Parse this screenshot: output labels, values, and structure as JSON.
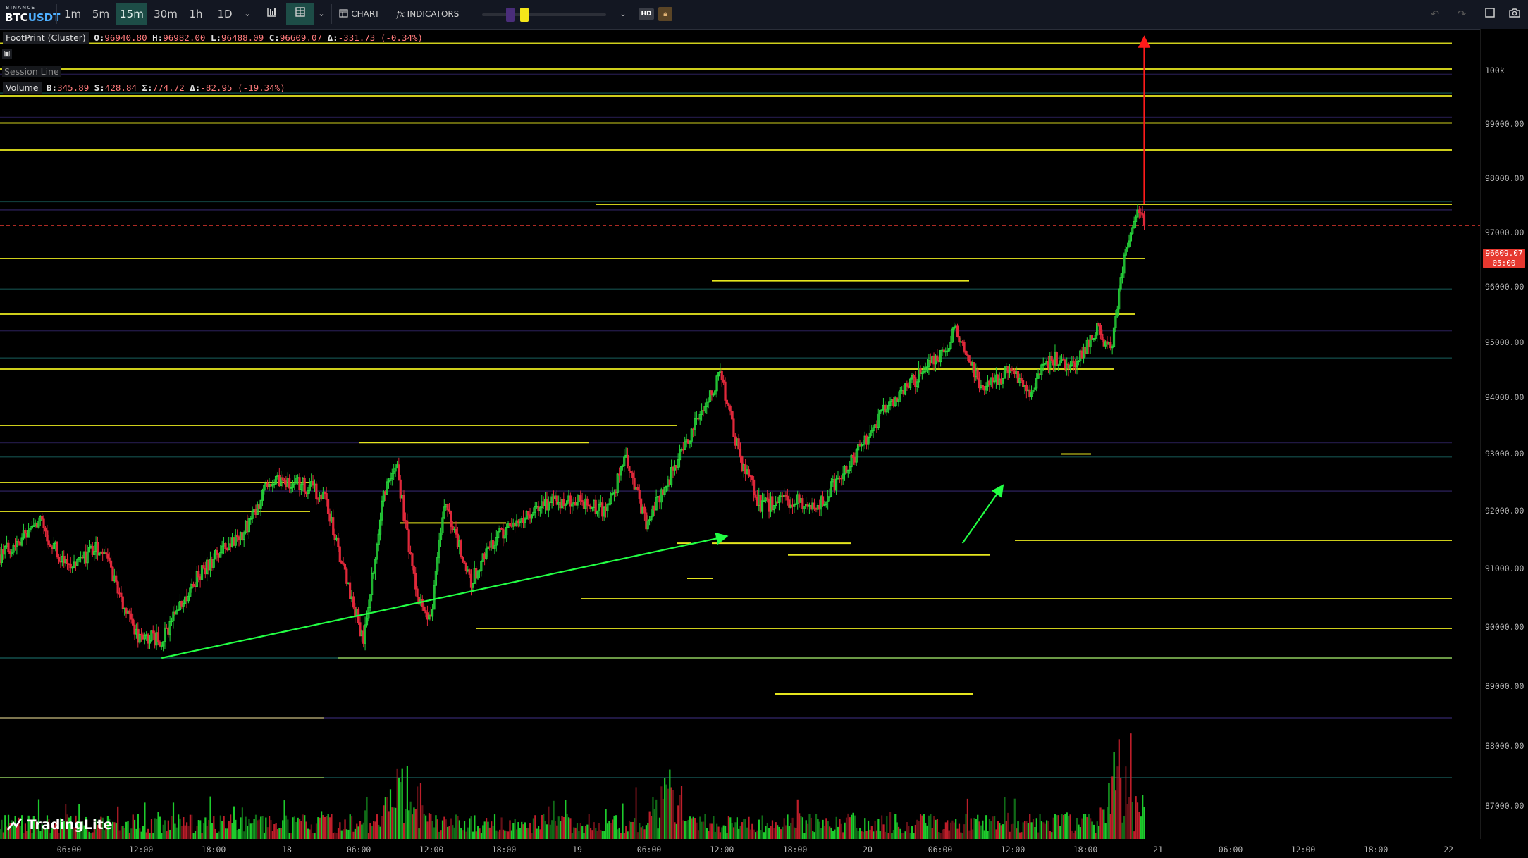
{
  "toolbar": {
    "exchange": "BINANCE",
    "symbol_base": "BTC",
    "symbol_quote": "USDT",
    "timeframes": [
      "1m",
      "5m",
      "15m",
      "30m",
      "1h",
      "1D"
    ],
    "active_timeframe": "15m",
    "chart_label": "CHART",
    "indicators_label": "INDICATORS",
    "hd_label": "HD"
  },
  "legend": {
    "footprint_title": "FootPrint (Cluster)",
    "open_label": "O:",
    "open": "96940.80",
    "high_label": "H:",
    "high": "96982.00",
    "low_label": "L:",
    "low": "96488.09",
    "close_label": "C:",
    "close": "96609.07",
    "delta_label": "Δ:",
    "delta": "-331.73 (-0.34%)",
    "session_line": "Session Line",
    "volume_title": "Volume",
    "buy_label": "B:",
    "buy": "345.89",
    "sell_label": "S:",
    "sell": "428.84",
    "sum_label": "Σ:",
    "sum": "774.72",
    "vdelta_label": "Δ:",
    "vdelta": "-82.95 (-19.34%)"
  },
  "price_axis": [
    "100k",
    "99000.00",
    "98000.00",
    "97000.00",
    "96000.00",
    "95000.00",
    "94000.00",
    "93000.00",
    "92000.00",
    "91000.00",
    "90000.00",
    "89000.00",
    "88000.00",
    "87000.00"
  ],
  "time_axis": [
    "06:00",
    "12:00",
    "18:00",
    "18",
    "06:00",
    "12:00",
    "18:00",
    "19",
    "06:00",
    "12:00",
    "18:00",
    "20",
    "06:00",
    "12:00",
    "18:00",
    "21",
    "06:00",
    "12:00",
    "18:00",
    "22"
  ],
  "current_price": {
    "value": "96609.07",
    "countdown": "05:00"
  },
  "logo": "TradingLite",
  "colors": {
    "up": "#26d43a",
    "down": "#e0283a",
    "level": "#e5e51e",
    "arrow_green": "#22ff44",
    "arrow_red": "#ff1a1a",
    "accent": "#1d4d47"
  },
  "chart_data": {
    "type": "candlestick",
    "symbol": "BTCUSDT",
    "interval": "15m",
    "ylim": [
      86500,
      100300
    ],
    "price_ticks": [
      100000,
      99000,
      98000,
      97000,
      96000,
      95000,
      94000,
      93000,
      92000,
      91000,
      90000,
      89000,
      88000,
      87000
    ],
    "last_price": 96609.07,
    "close_path": [
      {
        "t": 0,
        "p": 90750
      },
      {
        "t": 6,
        "p": 91300
      },
      {
        "t": 10,
        "p": 90500
      },
      {
        "t": 15,
        "p": 90900
      },
      {
        "t": 20,
        "p": 89400
      },
      {
        "t": 24,
        "p": 89300
      },
      {
        "t": 30,
        "p": 90500
      },
      {
        "t": 36,
        "p": 91100
      },
      {
        "t": 40,
        "p": 92000
      },
      {
        "t": 44,
        "p": 92000
      },
      {
        "t": 48,
        "p": 91800
      },
      {
        "t": 52,
        "p": 90100
      },
      {
        "t": 54,
        "p": 89300
      },
      {
        "t": 57,
        "p": 91800
      },
      {
        "t": 59,
        "p": 92200
      },
      {
        "t": 62,
        "p": 90000
      },
      {
        "t": 64,
        "p": 89700
      },
      {
        "t": 66,
        "p": 91700
      },
      {
        "t": 70,
        "p": 90300
      },
      {
        "t": 74,
        "p": 91100
      },
      {
        "t": 80,
        "p": 91600
      },
      {
        "t": 86,
        "p": 91700
      },
      {
        "t": 90,
        "p": 91500
      },
      {
        "t": 93,
        "p": 92400
      },
      {
        "t": 96,
        "p": 91300
      },
      {
        "t": 100,
        "p": 92200
      },
      {
        "t": 104,
        "p": 93200
      },
      {
        "t": 107,
        "p": 93900
      },
      {
        "t": 110,
        "p": 92400
      },
      {
        "t": 113,
        "p": 91600
      },
      {
        "t": 118,
        "p": 91700
      },
      {
        "t": 121,
        "p": 91500
      },
      {
        "t": 126,
        "p": 92300
      },
      {
        "t": 131,
        "p": 93200
      },
      {
        "t": 135,
        "p": 93700
      },
      {
        "t": 140,
        "p": 94300
      },
      {
        "t": 142,
        "p": 94700
      },
      {
        "t": 146,
        "p": 93600
      },
      {
        "t": 150,
        "p": 94000
      },
      {
        "t": 153,
        "p": 93600
      },
      {
        "t": 156,
        "p": 94200
      },
      {
        "t": 160,
        "p": 94100
      },
      {
        "t": 163,
        "p": 94800
      },
      {
        "t": 165,
        "p": 94300
      },
      {
        "t": 167,
        "p": 96000
      },
      {
        "t": 169,
        "p": 96900
      },
      {
        "t": 170,
        "p": 96609
      }
    ],
    "volume_spikes": [
      {
        "t": 60,
        "v": "high"
      },
      {
        "t": 100,
        "v": "high"
      },
      {
        "t": 167,
        "v": "highest"
      }
    ],
    "horizontal_levels": [
      99980,
      99500,
      99000,
      98500,
      98000,
      97000,
      96000,
      95000,
      94000,
      93000,
      92000,
      91500,
      91000,
      90000,
      89500,
      89000,
      88000,
      87000
    ],
    "annotations": [
      {
        "type": "arrow",
        "color": "green",
        "from": [
          24,
          89000
        ],
        "to": [
          108,
          91070
        ]
      },
      {
        "type": "arrow",
        "color": "green",
        "from": [
          143,
          90950
        ],
        "to": [
          149,
          91950
        ]
      },
      {
        "type": "arrow",
        "color": "red",
        "from": [
          170,
          97000
        ],
        "to": [
          170,
          100100
        ]
      }
    ]
  }
}
